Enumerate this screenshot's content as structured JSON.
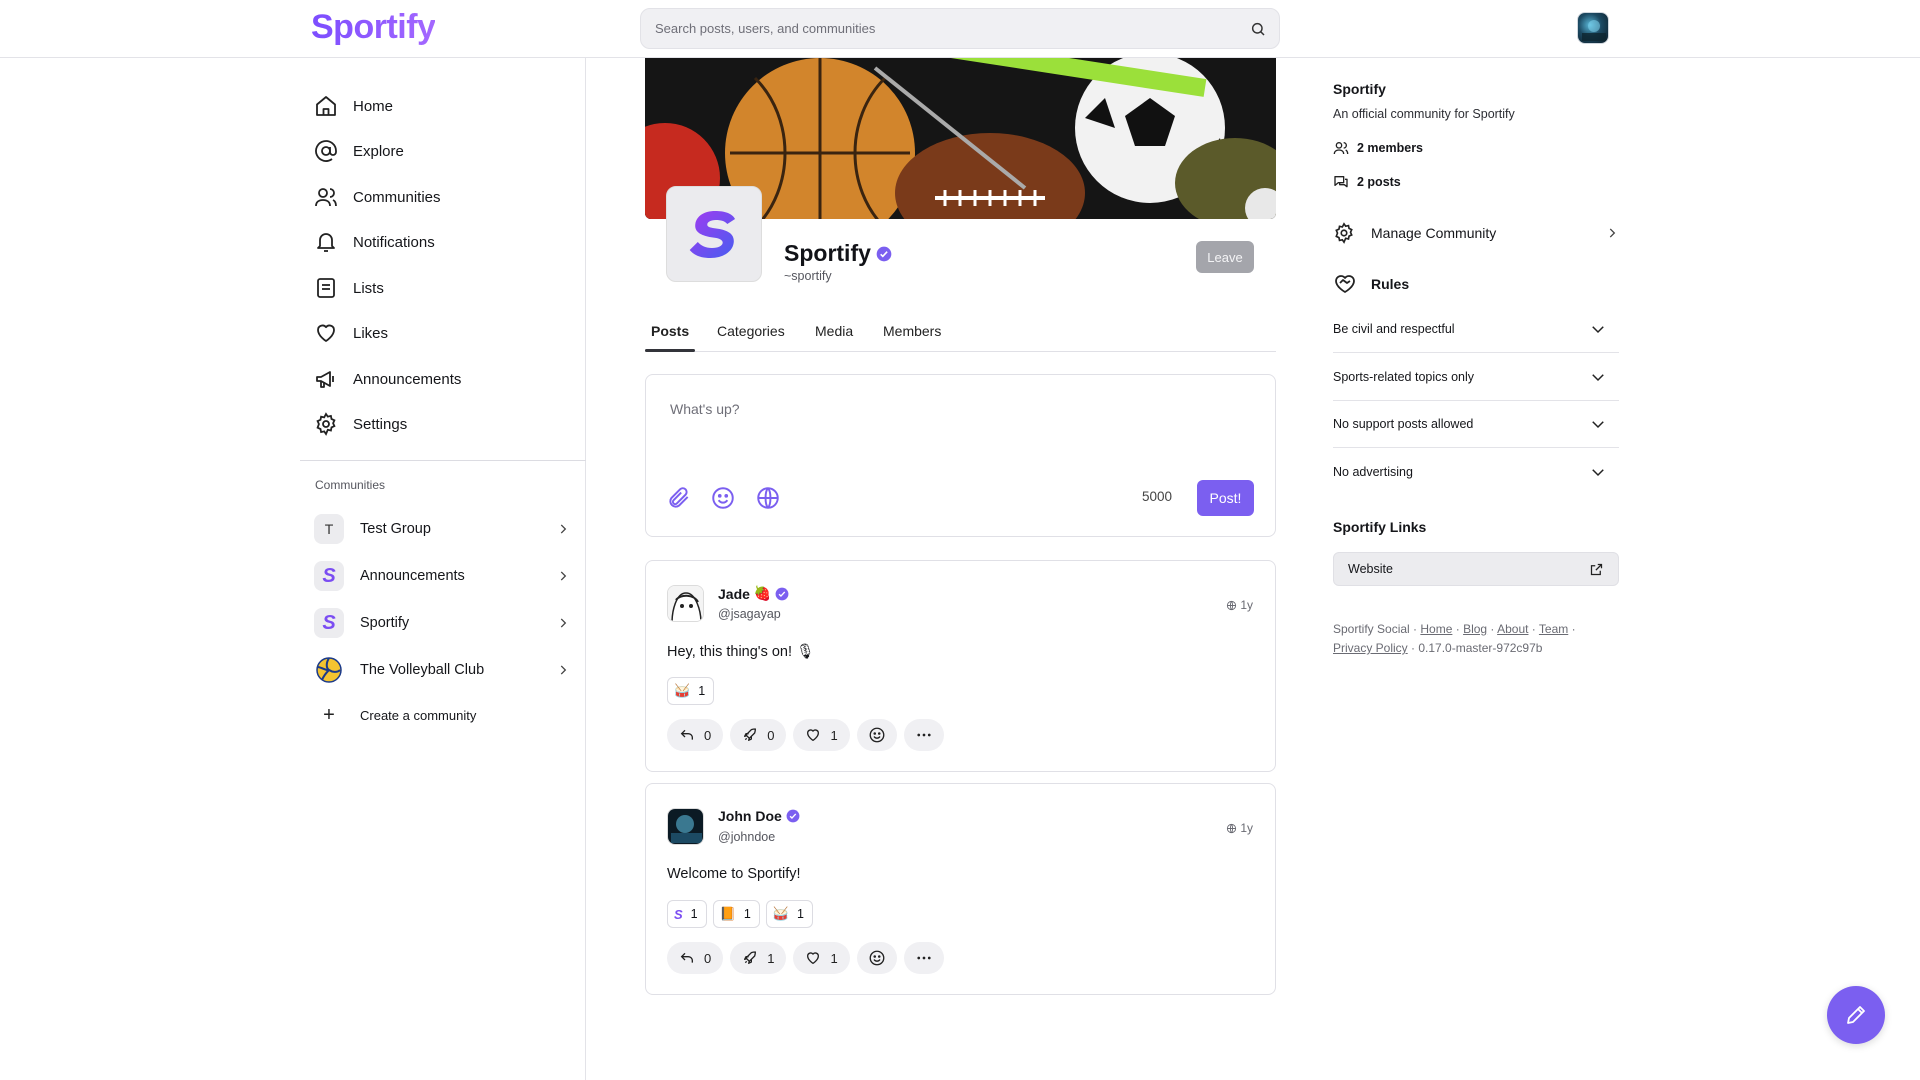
{
  "app": {
    "logo_text": "Sportify",
    "brand_color": "#7b5ff0"
  },
  "search": {
    "placeholder": "Search posts, users, and communities"
  },
  "sidebar": {
    "nav": [
      {
        "label": "Home",
        "icon": "home-icon"
      },
      {
        "label": "Explore",
        "icon": "at-sign-icon"
      },
      {
        "label": "Communities",
        "icon": "users-icon"
      },
      {
        "label": "Notifications",
        "icon": "bell-icon"
      },
      {
        "label": "Lists",
        "icon": "list-icon"
      },
      {
        "label": "Likes",
        "icon": "heart-icon"
      },
      {
        "label": "Announcements",
        "icon": "megaphone-icon"
      },
      {
        "label": "Settings",
        "icon": "gear-icon"
      }
    ],
    "communities_heading": "Communities",
    "communities": [
      {
        "label": "Test Group",
        "avatar_letter": "T"
      },
      {
        "label": "Announcements",
        "avatar_letter": "S"
      },
      {
        "label": "Sportify",
        "avatar_letter": "S"
      },
      {
        "label": "The Volleyball Club",
        "avatar_letter": ""
      }
    ],
    "create_label": "Create a community"
  },
  "community": {
    "name": "Sportify",
    "handle": "~sportify",
    "leave_label": "Leave",
    "logo_letter": "S"
  },
  "tabs": [
    {
      "label": "Posts",
      "active": true
    },
    {
      "label": "Categories",
      "active": false
    },
    {
      "label": "Media",
      "active": false
    },
    {
      "label": "Members",
      "active": false
    }
  ],
  "composer": {
    "placeholder": "What's up?",
    "char_count": "5000",
    "post_label": "Post!"
  },
  "posts": [
    {
      "author": "Jade",
      "author_emoji": "🍓",
      "handle": "@jsagayap",
      "time": "1y",
      "body": "Hey, this thing's on! 🎙",
      "reactions": [
        {
          "icon": "🥁",
          "count": "1"
        }
      ],
      "replies": "0",
      "reposts": "0",
      "likes": "1"
    },
    {
      "author": "John Doe",
      "author_emoji": "",
      "handle": "@johndoe",
      "time": "1y",
      "body": "Welcome to Sportify!",
      "reactions": [
        {
          "icon": "S",
          "count": "1"
        },
        {
          "icon": "📙",
          "count": "1"
        },
        {
          "icon": "🥁",
          "count": "1"
        }
      ],
      "replies": "0",
      "reposts": "1",
      "likes": "1"
    }
  ],
  "about": {
    "title": "Sportify",
    "description": "An official community for Sportify",
    "members": "2 members",
    "posts": "2 posts",
    "manage_label": "Manage Community",
    "rules_heading": "Rules",
    "rules": [
      "Be civil and respectful",
      "Sports-related topics only",
      "No support posts allowed",
      "No advertising"
    ],
    "links_heading": "Sportify Links",
    "links": [
      {
        "label": "Website"
      }
    ]
  },
  "footer": {
    "brand": "Sportify Social",
    "links": [
      "Home",
      "Blog",
      "About",
      "Team",
      "Privacy Policy"
    ],
    "version": "0.17.0-master-972c97b"
  }
}
